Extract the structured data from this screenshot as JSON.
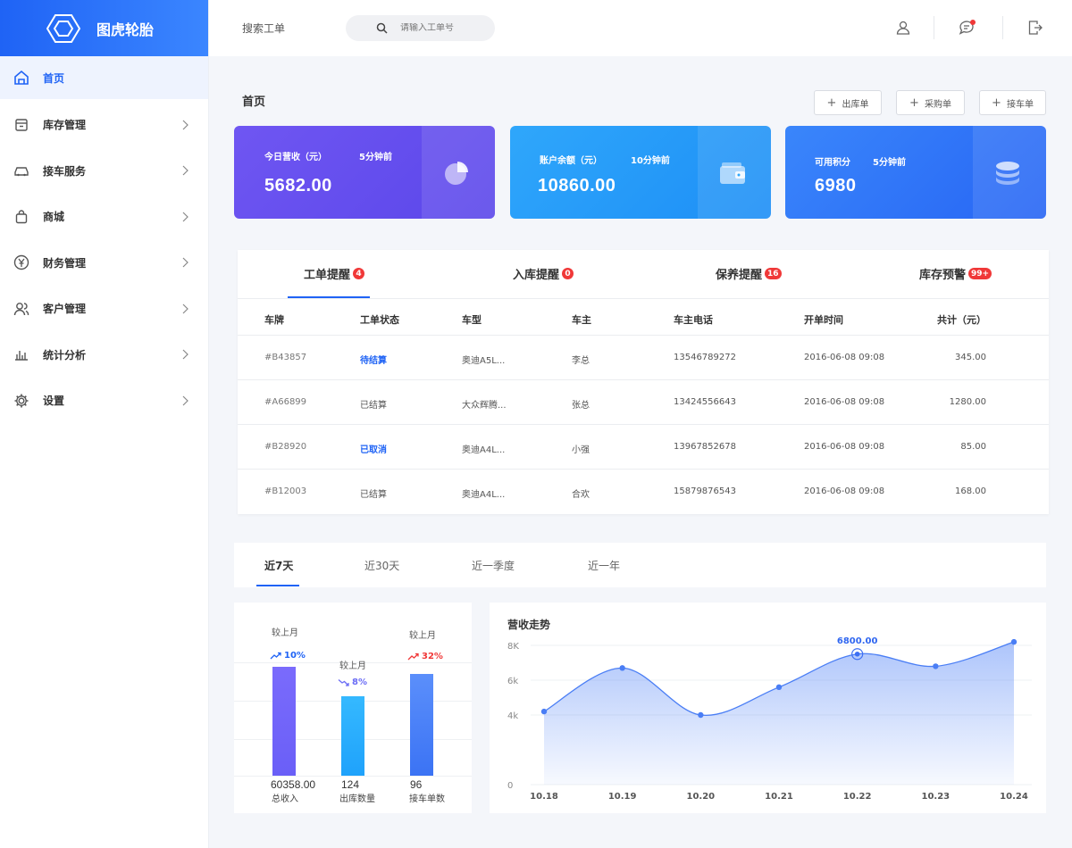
{
  "app": {
    "name": "图虎轮胎"
  },
  "sidebar": {
    "items": [
      {
        "label": "首页",
        "icon": "home-icon",
        "active": true
      },
      {
        "label": "库存管理",
        "icon": "inventory-icon"
      },
      {
        "label": "接车服务",
        "icon": "car-icon"
      },
      {
        "label": "商城",
        "icon": "shopping-bag-icon"
      },
      {
        "label": "财务管理",
        "icon": "yen-icon"
      },
      {
        "label": "客户管理",
        "icon": "users-icon"
      },
      {
        "label": "统计分析",
        "icon": "bar-chart-icon"
      },
      {
        "label": "设置",
        "icon": "gear-icon"
      }
    ]
  },
  "topbar": {
    "title": "搜索工单",
    "search_placeholder": "请输入工单号"
  },
  "page": {
    "title": "首页"
  },
  "quick_buttons": [
    "出库单",
    "采购单",
    "接车单"
  ],
  "cards": [
    {
      "label": "今日营收（元）",
      "time": "5分钟前",
      "value": "5682.00"
    },
    {
      "label": "账户余额（元）",
      "time": "10分钟前",
      "value": "10860.00"
    },
    {
      "label": "可用积分",
      "time": "5分钟前",
      "value": "6980"
    }
  ],
  "reminder_tabs": [
    {
      "label": "工单提醒",
      "badge": "4"
    },
    {
      "label": "入库提醒",
      "badge": "0"
    },
    {
      "label": "保养提醒",
      "badge": "16"
    },
    {
      "label": "库存预警",
      "badge": "99+"
    }
  ],
  "table": {
    "headers": [
      "车牌",
      "工单状态",
      "车型",
      "车主",
      "车主电话",
      "开单时间",
      "共计（元）"
    ],
    "rows": [
      [
        "#B43857",
        "待结算",
        "奥迪A5L...",
        "李总",
        "13546789272",
        "2016-06-08 09:08",
        "345.00"
      ],
      [
        "#A66899",
        "已结算",
        "大众辉腾...",
        "张总",
        "13424556643",
        "2016-06-08 09:08",
        "1280.00"
      ],
      [
        "#B28920",
        "已取消",
        "奥迪A4L...",
        "小强",
        "13967852678",
        "2016-06-08 09:08",
        "85.00"
      ],
      [
        "#B12003",
        "已结算",
        "奥迪A4L...",
        "合欢",
        "15879876543",
        "2016-06-08 09:08",
        "168.00"
      ]
    ]
  },
  "period_tabs": [
    "近7天",
    "近30天",
    "近一季度",
    "近一年"
  ],
  "summary": [
    {
      "compare": "较上月",
      "pct": "10%",
      "direction": "up",
      "value": "60358.00",
      "label": "总收入"
    },
    {
      "compare": "较上月",
      "pct": "8%",
      "direction": "down",
      "value": "124",
      "label": "出库数量"
    },
    {
      "compare": "较上月",
      "pct": "32%",
      "direction": "up",
      "value": "96",
      "label": "接车单数"
    }
  ],
  "colors": {
    "primary": "#1f63f5",
    "badge": "#f03838",
    "up_blue": "#1f63f5",
    "down_purple": "#6a6cf5",
    "up_red": "#f03838"
  },
  "chart_data": {
    "type": "area",
    "title": "营收走势",
    "categories": [
      "10.18",
      "10.19",
      "10.20",
      "10.21",
      "10.22",
      "10.23",
      "10.24"
    ],
    "values": [
      4200,
      6700,
      4000,
      5600,
      7500,
      6800,
      8200
    ],
    "highlight": {
      "index": 4,
      "label": "6800.00"
    },
    "y_ticks": [
      "0",
      "4k",
      "6k",
      "8K"
    ],
    "ylim": [
      0,
      8000
    ],
    "grid": true
  }
}
